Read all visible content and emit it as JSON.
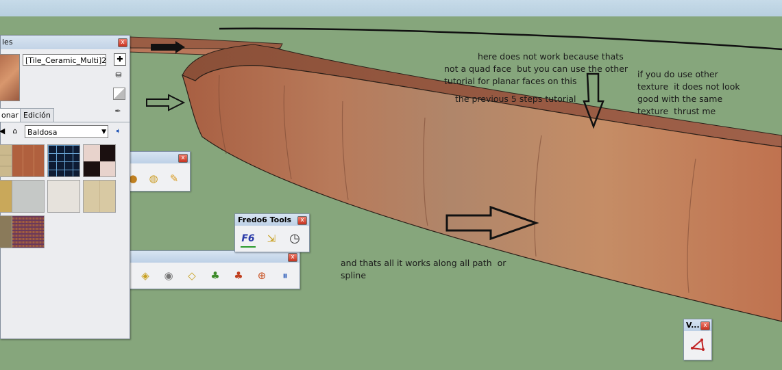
{
  "annotations": {
    "note1_line1": "here does not work because thats",
    "note1_line2": "not a quad face  but you can use the other",
    "note1_line3": "tutorial for planar faces on this",
    "note2": "the previous 5 steps tutorial",
    "note3_line1": "if you do use other",
    "note3_line2": "texture  it does not look",
    "note3_line3": "good with the same",
    "note3_line4": "texture  thrust me",
    "note4_line1": "and thats all it works along all path  or",
    "note4_line2": "spline"
  },
  "materials_panel": {
    "title": "les",
    "material_name": "[Tile_Ceramic_Multi]2",
    "tab_select": "onar",
    "tab_edit": "Edición",
    "library": "Baldosa",
    "close": "x",
    "swatches": [
      "sand-tile",
      "terracotta-tile",
      "blue-grid-tile",
      "checker-tile",
      "yellow-tile",
      "grey-stone-tile",
      "hexagon-tile",
      "beige-tile",
      "mosaic-tile",
      "multicolor-mosaic-tile"
    ]
  },
  "toolbars": {
    "fredo6_title": "Fredo6 Tools",
    "fredo6_icon1": "F6",
    "v_title": "V..."
  },
  "colors": {
    "ground": "#86a67c",
    "wall_top": "#9b5a40",
    "wall_face": "#c3825b",
    "titlebar": "#c8d8ea",
    "close": "#d5412d"
  }
}
